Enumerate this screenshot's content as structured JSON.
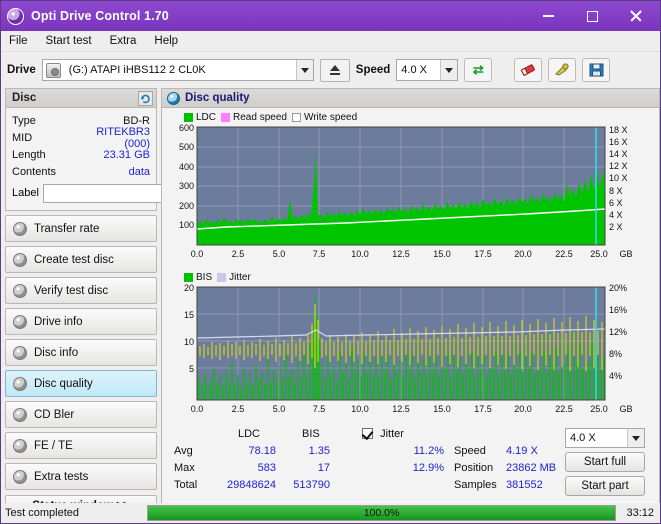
{
  "window": {
    "title": "Opti Drive Control 1.70"
  },
  "menu": [
    "File",
    "Start test",
    "Extra",
    "Help"
  ],
  "toolbar": {
    "drive_label": "Drive",
    "drive_value": "(G:)  ATAPI iHBS112   2 CL0K",
    "speed_label": "Speed",
    "speed_value": "4.0 X"
  },
  "disc": {
    "panel_title": "Disc",
    "type_key": "Type",
    "type_value": "BD-R",
    "mid_key": "MID",
    "mid_value": "RITEKBR3 (000)",
    "length_key": "Length",
    "length_value": "23.31 GB",
    "contents_key": "Contents",
    "contents_value": "data",
    "label_key": "Label",
    "label_value": ""
  },
  "nav": [
    {
      "label": "Transfer rate",
      "name": "transfer-rate"
    },
    {
      "label": "Create test disc",
      "name": "create-test-disc"
    },
    {
      "label": "Verify test disc",
      "name": "verify-test-disc"
    },
    {
      "label": "Drive info",
      "name": "drive-info"
    },
    {
      "label": "Disc info",
      "name": "disc-info"
    },
    {
      "label": "Disc quality",
      "name": "disc-quality"
    },
    {
      "label": "CD Bler",
      "name": "cd-bler"
    },
    {
      "label": "FE / TE",
      "name": "fe-te"
    },
    {
      "label": "Extra tests",
      "name": "extra-tests"
    }
  ],
  "nav_active_index": 5,
  "status_window_label": "Status window >>",
  "main": {
    "title": "Disc quality"
  },
  "chart_data": [
    {
      "type": "area",
      "name": "ldc-chart",
      "title": "",
      "xlabel": "GB",
      "legend": [
        {
          "label": "LDC",
          "color": "#00c000"
        },
        {
          "label": "Read speed",
          "color": "#ff80ff"
        },
        {
          "label": "Write speed",
          "color": "#ffffff"
        }
      ],
      "x_ticks": [
        "0.0",
        "2.5",
        "5.0",
        "7.5",
        "10.0",
        "12.5",
        "15.0",
        "17.5",
        "20.0",
        "22.5",
        "25.0"
      ],
      "xlim": [
        0,
        25
      ],
      "y_left_ticks": [
        "600",
        "500",
        "400",
        "300",
        "200",
        "100"
      ],
      "ylim_left": [
        0,
        600
      ],
      "y_right_ticks": [
        "18 X",
        "16 X",
        "14 X",
        "12 X",
        "10 X",
        "8 X",
        "6 X",
        "4 X",
        "2 X"
      ],
      "ylim_right": [
        0,
        19
      ],
      "grid": true,
      "bg": "#6c7c9c",
      "read_speed_series": "flat rising ~3.3X to ~4.3X across disc",
      "values_note": "LDC errors mostly 120-200, spikes to ~560 near 7.5GB, rising to ~380 near 23GB"
    },
    {
      "type": "area",
      "name": "bis-jitter-chart",
      "title": "",
      "xlabel": "GB",
      "legend": [
        {
          "label": "BIS",
          "color": "#00c000"
        },
        {
          "label": "Jitter",
          "color": "#c8c8e8"
        }
      ],
      "x_ticks": [
        "0.0",
        "2.5",
        "5.0",
        "7.5",
        "10.0",
        "12.5",
        "15.0",
        "17.5",
        "20.0",
        "22.5",
        "25.0"
      ],
      "xlim": [
        0,
        25
      ],
      "y_left_ticks": [
        "20",
        "15",
        "10",
        "5"
      ],
      "ylim_left": [
        0,
        21
      ],
      "y_right_ticks": [
        "20%",
        "16%",
        "12%",
        "8%",
        "4%"
      ],
      "ylim_right": [
        0,
        21
      ],
      "grid": true,
      "bg": "#6c7c9c",
      "values_note": "BIS mostly 2-8 with spikes to 20 near 7.5GB; jitter line ~11-13%"
    }
  ],
  "stats": {
    "col_ldc": "LDC",
    "col_bis": "BIS",
    "jitter_label": "Jitter",
    "rows": [
      {
        "key": "Avg",
        "ldc": "78.18",
        "bis": "1.35",
        "jitter": "11.2%"
      },
      {
        "key": "Max",
        "ldc": "583",
        "bis": "17",
        "jitter": "12.9%"
      },
      {
        "key": "Total",
        "ldc": "29848624",
        "bis": "513790",
        "jitter": ""
      }
    ],
    "speed_label": "Speed",
    "speed_value": "4.19 X",
    "position_label": "Position",
    "position_value": "23862 MB",
    "samples_label": "Samples",
    "samples_value": "381552",
    "speed_select": "4.0 X",
    "start_full": "Start full",
    "start_part": "Start part"
  },
  "bottom": {
    "status": "Test completed",
    "progress_text": "100.0%",
    "progress_percent": 100,
    "time": "33:12"
  }
}
